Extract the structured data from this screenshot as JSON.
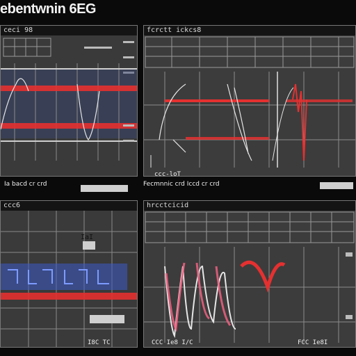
{
  "app": {
    "title": "ebentwnin 6EG"
  },
  "panels": [
    {
      "id": "p1",
      "header": "ceci 98",
      "caption": "Ia bacd cr crd",
      "button": ""
    },
    {
      "id": "p2",
      "header": "fcrctt ickcs8",
      "caption": "Fecmnnic crd Iccd cr crd",
      "button": ""
    },
    {
      "id": "p3",
      "header": "ccc6",
      "caption": "",
      "button": ""
    },
    {
      "id": "p4",
      "header": "hrcctcicid",
      "caption": "",
      "button": ""
    }
  ],
  "footer": {
    "left_readout": "I8C TC",
    "center_readout": "CCC Ie8 I/C",
    "right_readout": "FCC Ie8I"
  },
  "markers": {
    "p2_mid": "ccc-loT",
    "p3_side": "IaI"
  },
  "colors": {
    "accent": "#e53030",
    "trace": "#d8d8d8",
    "blue_band": "#3b59c8",
    "pink": "#f06080"
  }
}
